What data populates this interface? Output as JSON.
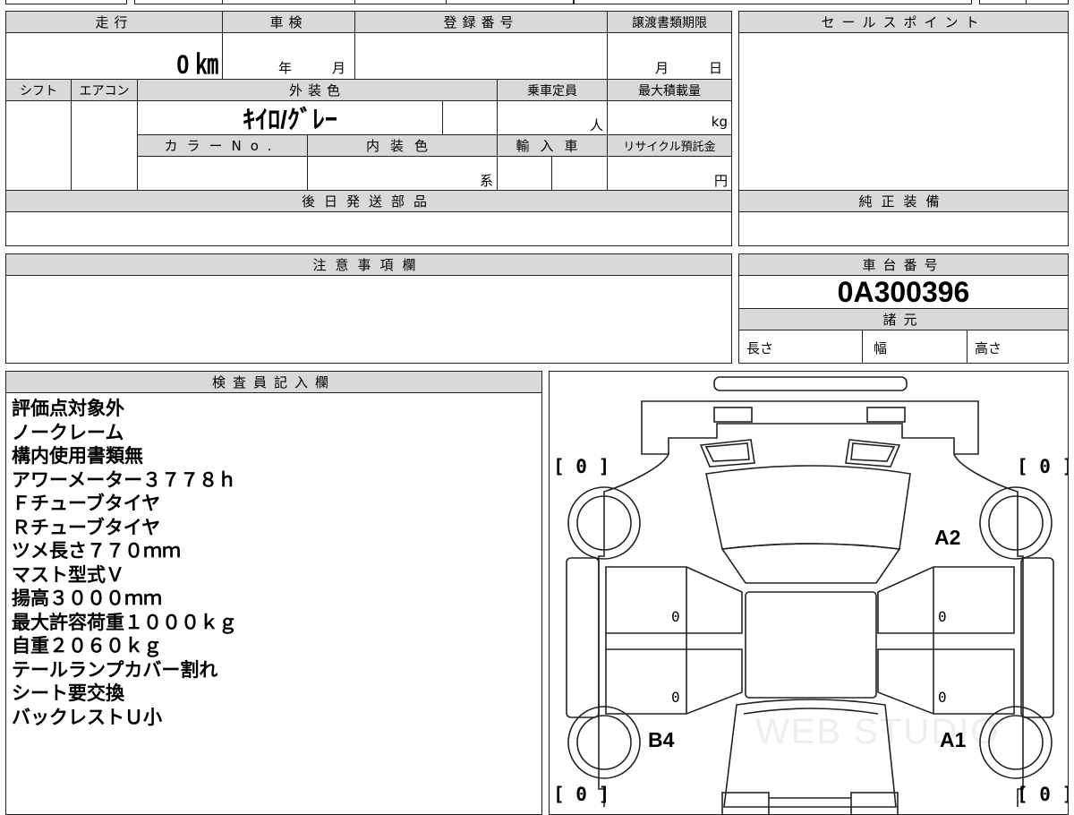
{
  "sheet": {
    "mileage_header": "走行",
    "mileage_value": "0 ㎞",
    "inspection_header": "車検",
    "inspection_year_unit": "年",
    "inspection_month_unit": "月",
    "registration_header": "登録番号",
    "transfer_deadline_header": "譲渡書類期限",
    "transfer_month_unit": "月",
    "transfer_day_unit": "日",
    "sales_point_header": "セールスポイント",
    "shift_header": "シフト",
    "aircon_header": "エアコン",
    "exterior_color_header": "外装色",
    "exterior_color_value": "ｷｲﾛ/ｸﾞﾚｰ",
    "capacity_header": "乗車定員",
    "capacity_unit": "人",
    "max_load_header": "最大積載量",
    "max_load_unit": "kg",
    "color_no_header": "カラーNo.",
    "interior_color_header": "内装色",
    "interior_color_unit": "系",
    "import_header": "輸入車",
    "recycle_header": "リサイクル預託金",
    "recycle_unit": "円",
    "later_parts_header": "後日発送部品",
    "genuine_equipment_header": "純正装備",
    "notice_header": "注意事項欄",
    "chassis_header": "車台番号",
    "chassis_value": "0A300396",
    "specs_header": "諸元",
    "length_label": "長さ",
    "width_label": "幅",
    "height_label": "高さ",
    "inspector_header": "検査員記入欄"
  },
  "inspector_notes": [
    "評価点対象外",
    "ノークレーム",
    "構内使用書類無",
    "アワーメーター３７７８ｈ",
    "Ｆチューブタイヤ",
    "Ｒチューブタイヤ",
    "ツメ長さ７７０ｍｍ",
    "マスト型式Ｖ",
    "揚高３０００ｍｍ",
    "最大許容荷重１０００ｋｇ",
    "自重２０６０ｋｇ",
    "テールランプカバー割れ",
    "シート要交換",
    "バックレストＵ小"
  ],
  "diagram": {
    "tire_front_left": "[ 0 ]",
    "tire_front_right": "[ 0 ]",
    "tire_rear_left": "[ 0 ]",
    "tire_rear_right": "[ 0 ]",
    "damage_a2": "A2",
    "damage_b4": "B4",
    "damage_a1": "A1",
    "panel_left_upper": "0",
    "panel_left_lower": "0",
    "panel_right_upper": "0",
    "panel_right_lower": "0",
    "watermark": "WEB STUDIO"
  }
}
